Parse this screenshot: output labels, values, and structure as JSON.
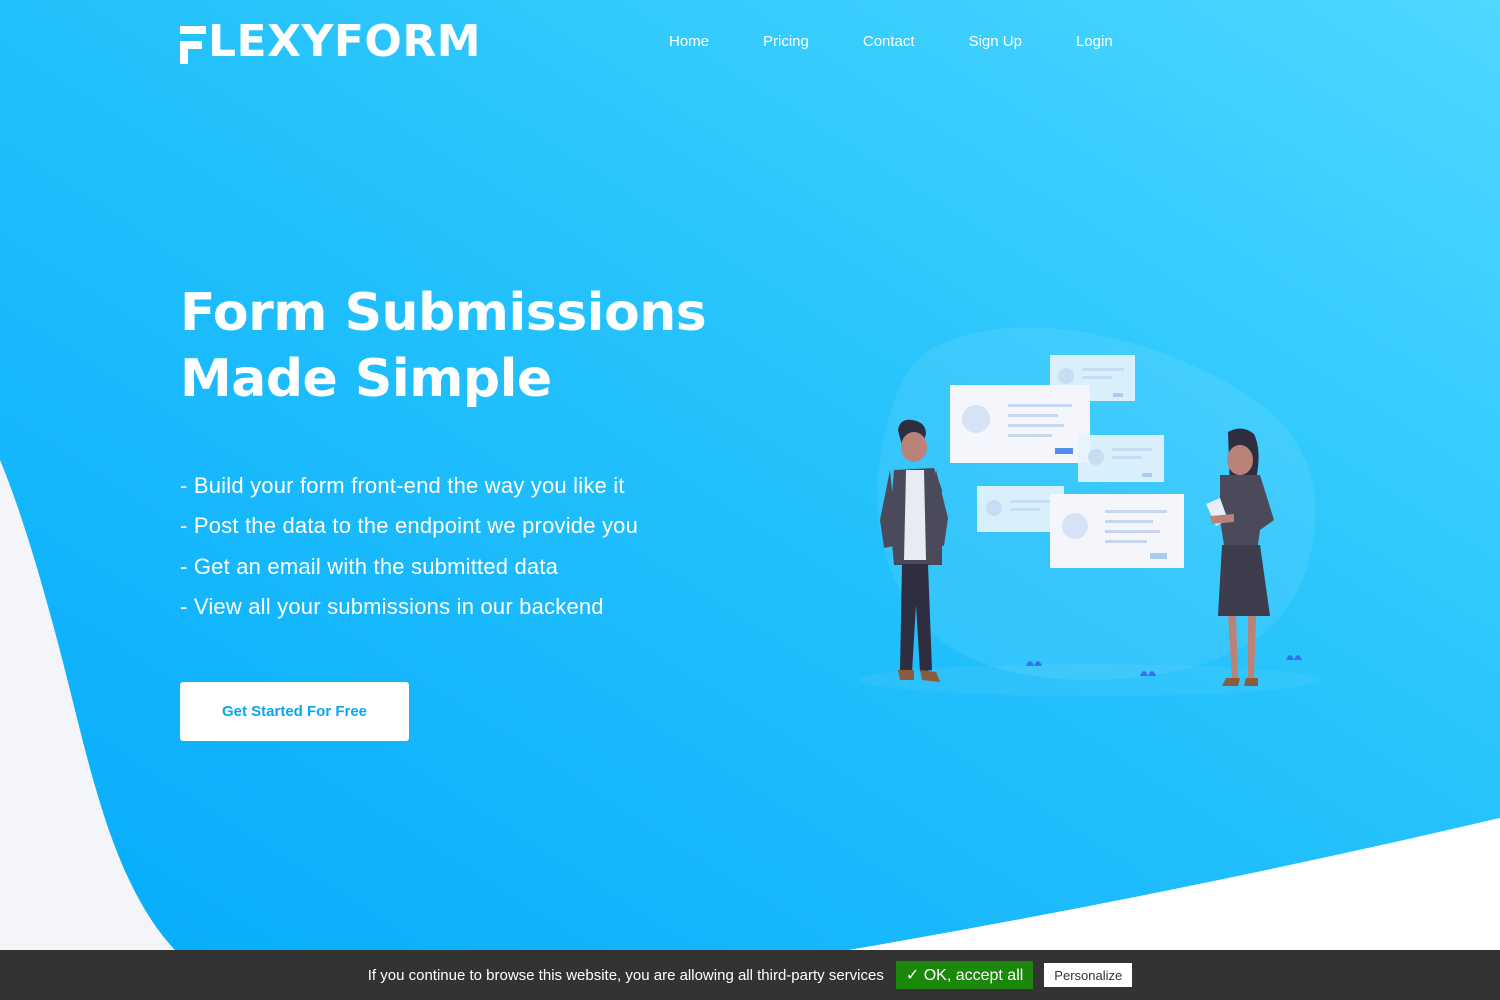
{
  "brand": {
    "name": "LEXYFORM",
    "logo_alt": "FLEXYFORM"
  },
  "nav": {
    "items": [
      "Home",
      "Pricing",
      "Contact",
      "Sign Up",
      "Login"
    ]
  },
  "hero": {
    "title_line1": "Form Submissions",
    "title_line2": "Made Simple",
    "features": [
      "- Build your form front-end the way you like it",
      "- Post the data to the endpoint we provide you",
      "- Get an email with the submitted data",
      "- View all your submissions in our backend"
    ],
    "cta_label": "Get Started For Free"
  },
  "cookie_banner": {
    "message": "If you continue to browse this website, you are allowing all third-party services",
    "accept_label": "✓ OK, accept all",
    "personalize_label": "Personalize"
  },
  "colors": {
    "gradient_start": "#05abfb",
    "gradient_end": "#4dd8ff",
    "cta_text": "#0aa5f0",
    "cookie_bg": "#333333",
    "accept_bg": "#1b870b"
  }
}
